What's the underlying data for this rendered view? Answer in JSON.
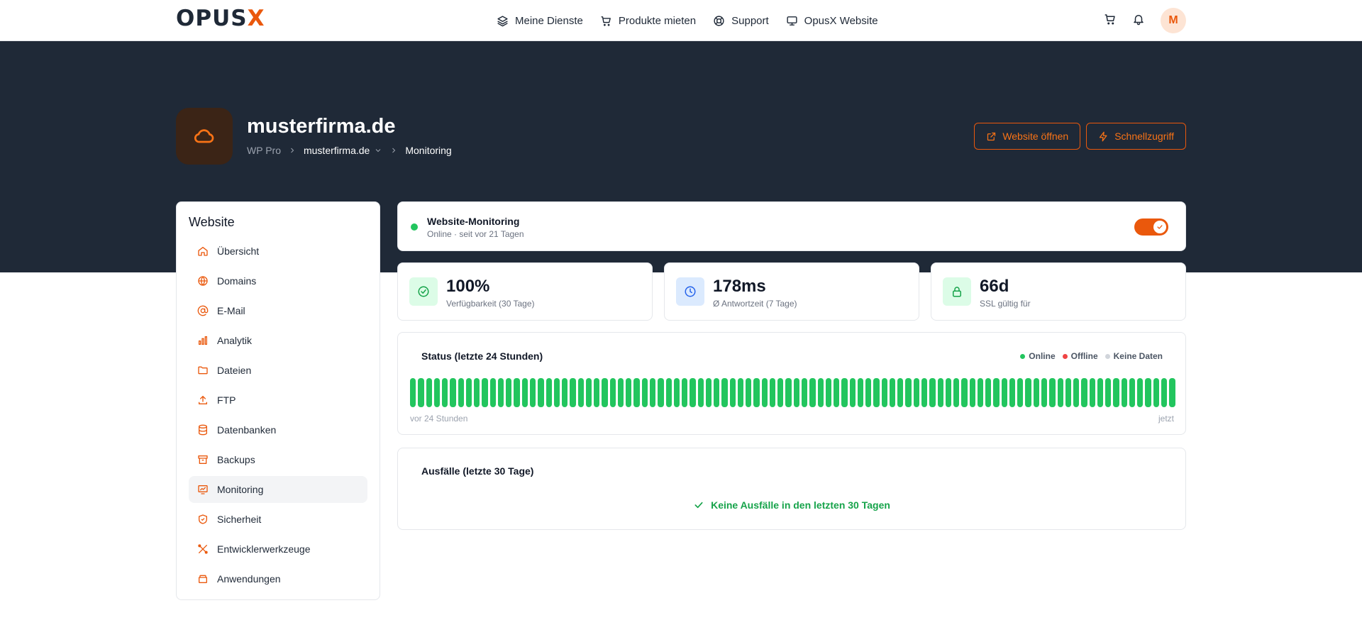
{
  "nav": {
    "logo_main": "OPUS",
    "logo_accent": "X",
    "links": [
      {
        "label": "Meine Dienste",
        "icon": "layers-icon"
      },
      {
        "label": "Produkte mieten",
        "icon": "cart-icon"
      },
      {
        "label": "Support",
        "icon": "lifebuoy-icon"
      },
      {
        "label": "OpusX Website",
        "icon": "monitor-icon"
      }
    ],
    "avatar_initial": "M"
  },
  "hero": {
    "title": "musterfirma.de",
    "breadcrumb": {
      "root": "WP Pro",
      "site": "musterfirma.de",
      "current": "Monitoring"
    },
    "open_website_label": "Website öffnen",
    "quick_access_label": "Schnellzugriff"
  },
  "sidebar": {
    "title": "Website",
    "items": [
      {
        "label": "Übersicht",
        "icon": "home-icon"
      },
      {
        "label": "Domains",
        "icon": "globe-icon"
      },
      {
        "label": "E-Mail",
        "icon": "at-icon"
      },
      {
        "label": "Analytik",
        "icon": "bar-chart-icon"
      },
      {
        "label": "Dateien",
        "icon": "folder-icon"
      },
      {
        "label": "FTP",
        "icon": "upload-icon"
      },
      {
        "label": "Datenbanken",
        "icon": "database-icon"
      },
      {
        "label": "Backups",
        "icon": "archive-icon"
      },
      {
        "label": "Monitoring",
        "icon": "monitoring-icon",
        "active": true
      },
      {
        "label": "Sicherheit",
        "icon": "shield-icon"
      },
      {
        "label": "Entwicklerwerkzeuge",
        "icon": "tools-icon"
      },
      {
        "label": "Anwendungen",
        "icon": "apps-icon"
      }
    ]
  },
  "monitoring": {
    "title": "Website-Monitoring",
    "subtitle": "Online · seit vor 21 Tagen",
    "enabled": true
  },
  "stats": [
    {
      "value": "100%",
      "label": "Verfügbarkeit (30 Tage)",
      "icon": "check-circle-icon",
      "color": "#16a34a",
      "bg": "#dcfce7"
    },
    {
      "value": "178ms",
      "label": "Ø Antwortzeit (7 Tage)",
      "icon": "clock-icon",
      "color": "#2563eb",
      "bg": "#dbeafe"
    },
    {
      "value": "66d",
      "label": "SSL gültig für",
      "icon": "lock-icon",
      "color": "#16a34a",
      "bg": "#dcfce7"
    }
  ],
  "status": {
    "title": "Status (letzte 24 Stunden)",
    "legend": [
      {
        "label": "Online",
        "color": "#22c55e"
      },
      {
        "label": "Offline",
        "color": "#ef4444"
      },
      {
        "label": "Keine Daten",
        "color": "#d1d5db"
      }
    ],
    "start_label": "vor 24 Stunden",
    "end_label": "jetzt",
    "bar_count": 96,
    "bar_state": "Online"
  },
  "outages": {
    "title": "Ausfälle (letzte 30 Tage)",
    "message": "Keine Ausfälle in den letzten 30 Tagen"
  },
  "colors": {
    "accent": "#ea580c",
    "hero_bg": "#1f2937",
    "online": "#22c55e"
  }
}
